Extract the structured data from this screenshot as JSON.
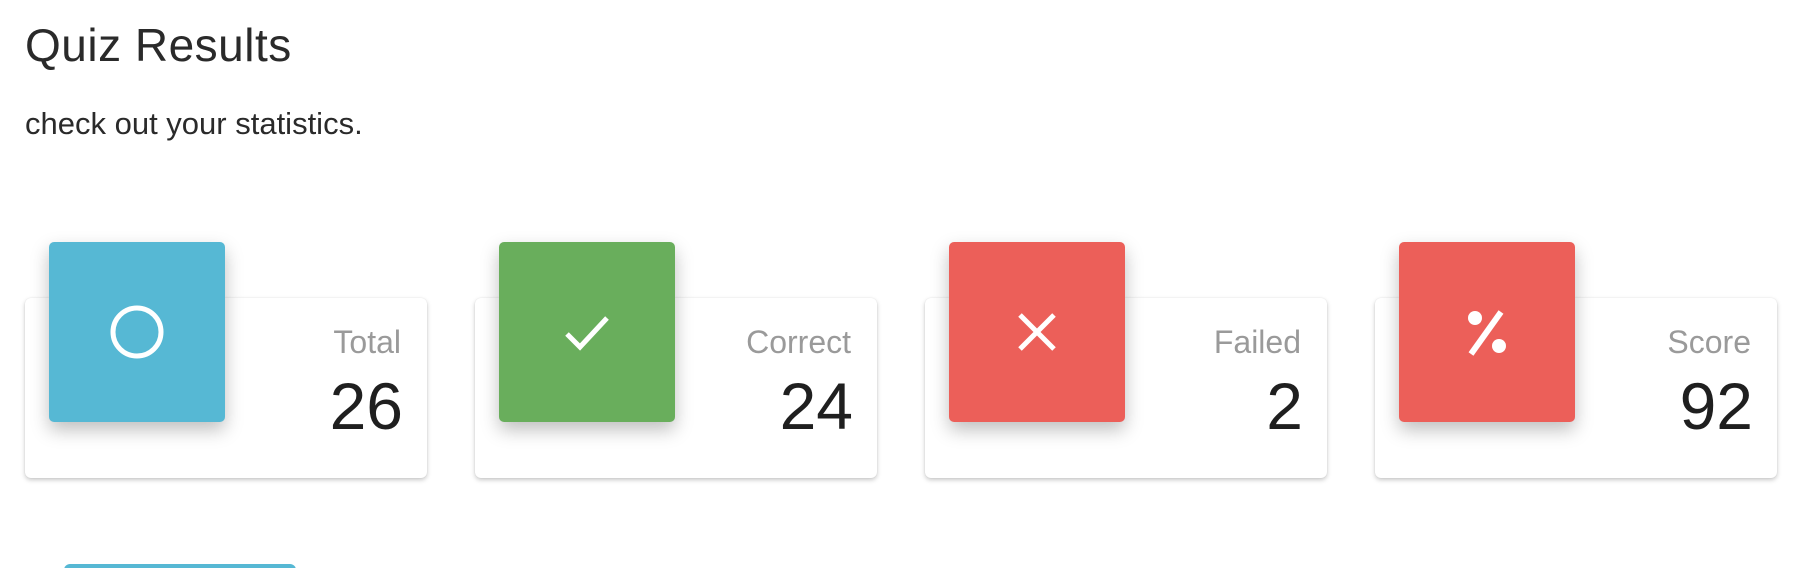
{
  "header": {
    "title": "Quiz Results",
    "subtitle": "check out your statistics."
  },
  "cards": [
    {
      "label": "Total",
      "value": "26",
      "icon": "circle-icon",
      "color": "#56b8d4"
    },
    {
      "label": "Correct",
      "value": "24",
      "icon": "check-icon",
      "color": "#69ae5c"
    },
    {
      "label": "Failed",
      "value": "2",
      "icon": "close-icon",
      "color": "#ec5f59"
    },
    {
      "label": "Score",
      "value": "92",
      "icon": "percent-icon",
      "color": "#ec5f59"
    }
  ],
  "colors": {
    "stub": "#56b8d4"
  }
}
